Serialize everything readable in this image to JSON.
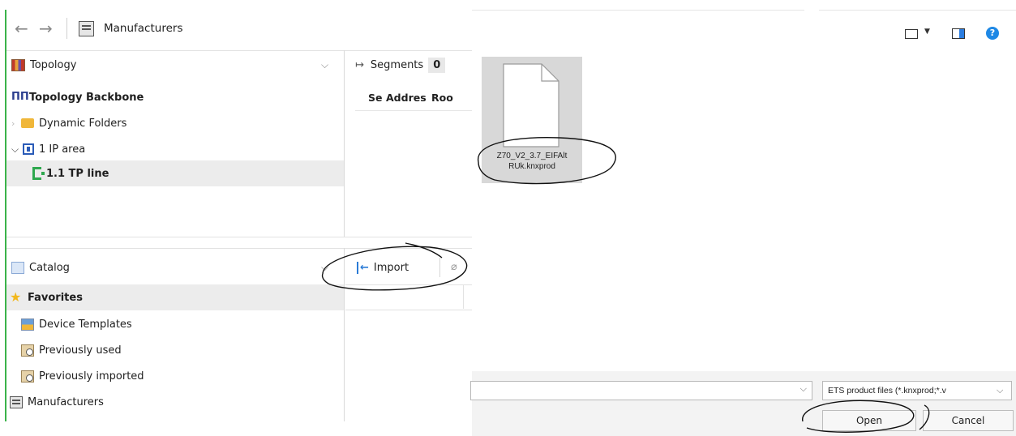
{
  "nav": {
    "back": "←",
    "forward": "→",
    "title": "Manufacturers"
  },
  "topology": {
    "header": "Topology",
    "items": [
      {
        "label": "Topology Backbone"
      },
      {
        "label": "Dynamic Folders"
      },
      {
        "label": "1 IP area"
      },
      {
        "label": "1.1 TP line"
      }
    ]
  },
  "segments": {
    "label": "Segments",
    "count": "0",
    "columns": [
      "Se",
      "Addres",
      "Roo"
    ]
  },
  "catalog": {
    "header": "Catalog",
    "items": [
      {
        "label": "Favorites"
      },
      {
        "label": "Device Templates"
      },
      {
        "label": "Previously used"
      },
      {
        "label": "Previously imported"
      },
      {
        "label": "Manufacturers"
      }
    ],
    "import_label": "Import"
  },
  "dialog": {
    "file": {
      "line1": "Z70_V2_3.7_EIFAlt",
      "line2": "RUk.knxprod"
    },
    "filter": "ETS product files (*.knxprod;*.v",
    "open_label": "Open",
    "cancel_label": "Cancel",
    "colors": {
      "help": "#1e88e5",
      "annotation": "#111111"
    }
  }
}
